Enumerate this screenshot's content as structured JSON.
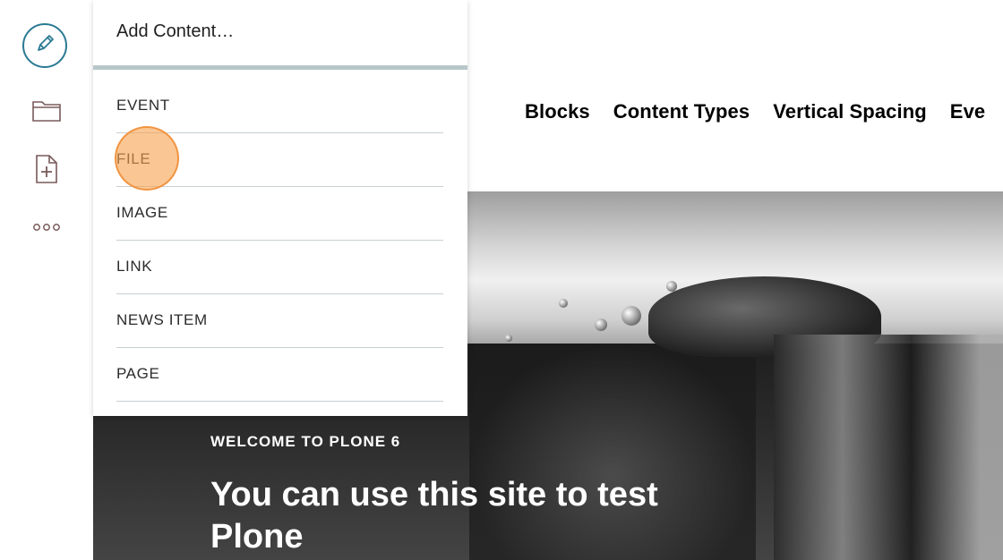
{
  "toolbar": {
    "edit_icon": "pencil-icon",
    "contents_icon": "folder-icon",
    "add_icon": "add-document-icon",
    "more_icon": "more-icon",
    "accent": "#2b7a93"
  },
  "add_menu": {
    "title": "Add Content…",
    "items": [
      {
        "label": "EVENT"
      },
      {
        "label": "FILE"
      },
      {
        "label": "IMAGE"
      },
      {
        "label": "LINK"
      },
      {
        "label": "NEWS ITEM"
      },
      {
        "label": "PAGE"
      }
    ]
  },
  "nav": {
    "items": [
      {
        "label": "Blocks"
      },
      {
        "label": "Content Types"
      },
      {
        "label": "Vertical Spacing"
      },
      {
        "label": "Eve"
      }
    ]
  },
  "hero": {
    "kicker": "WELCOME TO PLONE 6",
    "title": "You can use this site to test Plone"
  },
  "highlight_color": "#f7a14c"
}
